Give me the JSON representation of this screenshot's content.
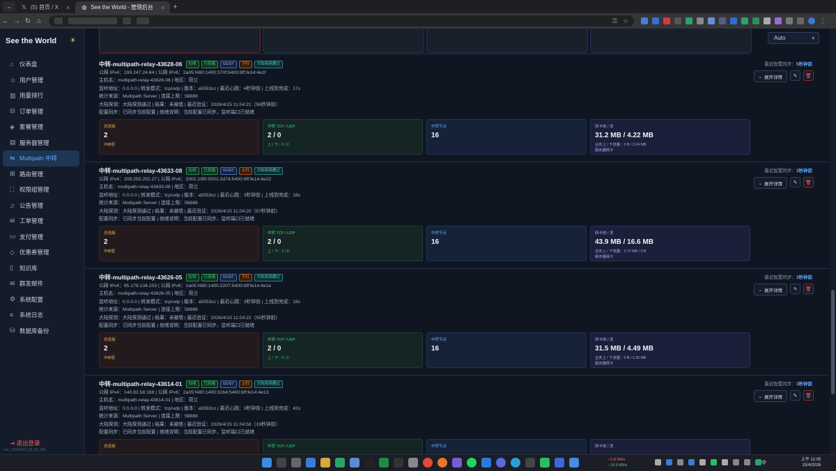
{
  "browser": {
    "tabs": [
      {
        "title": "(5) 首页 / X",
        "icon": "x-logo"
      },
      {
        "title": "See the World - 管理后台",
        "icon": "globe-icon"
      }
    ],
    "new_tab": "+",
    "menu_caret": "⌄"
  },
  "sidebar": {
    "brand": "See the World",
    "theme_icon": "☀",
    "items": [
      {
        "label": "仪表盘",
        "icon": "⌂",
        "active": false
      },
      {
        "label": "用户管理",
        "icon": "☺",
        "active": false
      },
      {
        "label": "用量排行",
        "icon": "▥",
        "active": false
      },
      {
        "label": "订单管理",
        "icon": "⊟",
        "active": false
      },
      {
        "label": "套餐管理",
        "icon": "◈",
        "active": false
      },
      {
        "label": "服务器管理",
        "icon": "▤",
        "active": false
      },
      {
        "label": "Multipath 中转",
        "icon": "⇋",
        "active": true
      },
      {
        "label": "路由管理",
        "icon": "⊞",
        "active": false
      },
      {
        "label": "权限组管理",
        "icon": "⛶",
        "active": false
      },
      {
        "label": "公告管理",
        "icon": "♫",
        "active": false
      },
      {
        "label": "工单管理",
        "icon": "✉",
        "active": false
      },
      {
        "label": "支付管理",
        "icon": "▭",
        "active": false
      },
      {
        "label": "优惠券管理",
        "icon": "◇",
        "active": false
      },
      {
        "label": "知识库",
        "icon": "▯",
        "active": false
      },
      {
        "label": "群发邮件",
        "icon": "✉",
        "active": false
      },
      {
        "label": "系统配置",
        "icon": "⚙",
        "active": false
      },
      {
        "label": "系统日志",
        "icon": "≡",
        "active": false
      },
      {
        "label": "数据库备份",
        "icon": "⛁",
        "active": false
      }
    ],
    "logout": "退出登录",
    "logout_icon": "⇥",
    "version": "ver_20260415_02_04_334"
  },
  "toolbar": {
    "select_value": "Auto"
  },
  "cards": [
    {
      "name": "中转-multipath-relay-43628-06",
      "tags": [
        "在线",
        "已就绪",
        "GOST",
        "下行",
        "大陆探测通过"
      ],
      "ip": "公网 IPv4：199.247.24.64 | 公网 IPv6：2a05:f480:1400:370f:5400:6ff:fe14:4e1f",
      "host": "主机名：multipath-relay-43628-06 | 地区：荷兰",
      "listen": "监听地址：0.0.0.0 | 转发模式：tcp/udp | 版本：a5553cc | 最近心跳：4秒钟前 | 上线到完成：17s",
      "source": "统计来源：Multipath Server | 连接上限：58888",
      "probe": "大陆探测：大陆探测通过 | 结果：未被墙 | 最近验证：2026/4/15 11:04:21（56秒钟前）",
      "config": "配置同步：已同步当前配置 | 就绪说明：当前配置已同步，监听端口已就绪",
      "sync_label": "最近配置同步：",
      "sync_value": "5秒钟前",
      "expand": "展开详情",
      "stats": {
        "conn_label": "总连接",
        "conn_value": "2",
        "conn_sub": "中转层",
        "tcp_label": "中转 TCP / UDP",
        "tcp_value": "2 / 0",
        "tcp_sub": "上 / 下：0 / 2",
        "node_label": "中转节点",
        "node_value": "16",
        "nic_label": "网卡收 / 发",
        "nic_value": "31.2 MB / 4.22 MB",
        "nic_sub": "业务上 / 下流量：0 B / 2.24 MB",
        "nic_sub2": "服务器网卡"
      }
    },
    {
      "name": "中转-multipath-relay-43633-08",
      "tags": [
        "在线",
        "已就绪",
        "GOST",
        "上行",
        "大陆探测通过"
      ],
      "ip": "公网 IPv4：209.250.252.27 | 公网 IPv6：2001:19f0:5001:3d74:5400:6ff:fe14:4e22",
      "host": "主机名：multipath-relay-43633-08 | 地区：荷兰",
      "listen": "监听地址：0.0.0.0 | 转发模式：tcp/udp | 版本：a5553cc | 最近心跳：3秒钟前 | 上线到完成：18s",
      "source": "统计来源：Multipath Server | 连接上限：58888",
      "probe": "大陆探测：大陆探测通过 | 结果：未被墙 | 最近验证：2026/4/15 11:04:20（57秒钟前）",
      "config": "配置同步：已同步当前配置 | 就绪说明：当前配置已同步，监听端口已就绪",
      "sync_label": "最近配置同步：",
      "sync_value": "3秒钟前",
      "expand": "展开详情",
      "stats": {
        "conn_label": "总连接",
        "conn_value": "2",
        "conn_sub": "中转层",
        "tcp_label": "中转 TCP / UDP",
        "tcp_value": "2 / 0",
        "tcp_sub": "上 / 下：2 / 0",
        "node_label": "中转节点",
        "node_value": "16",
        "nic_label": "网卡收 / 发",
        "nic_value": "43.9 MB / 16.6 MB",
        "nic_sub": "业务上 / 下流量：3.72 MB / 0 B",
        "nic_sub2": "服务器网卡"
      }
    },
    {
      "name": "中转-multipath-relay-43626-05",
      "tags": [
        "在线",
        "已就绪",
        "GOST",
        "下行",
        "大陆探测通过"
      ],
      "ip": "公网 IPv4：95.179.134.203 | 公网 IPv6：2a05:f480:1400:2207:5400:6ff:fe14:4e1e",
      "host": "主机名：multipath-relay-43626-05 | 地区：荷兰",
      "listen": "监听地址：0.0.0.0 | 转发模式：tcp/udp | 版本：a5553cc | 最近心跳：3秒钟前 | 上线到完成：18s",
      "source": "统计来源：Multipath Server | 连接上限：58888",
      "probe": "大陆探测：大陆探测通过 | 结果：未被墙 | 最近验证：2026/4/15 11:04:22（55秒钟前）",
      "config": "配置同步：已同步当前配置 | 就绪说明：当前配置已同步，监听端口已就绪",
      "sync_label": "最近配置同步：",
      "sync_value": "3秒钟前",
      "expand": "展开详情",
      "stats": {
        "conn_label": "总连接",
        "conn_value": "2",
        "conn_sub": "中转层",
        "tcp_label": "中转 TCP / UDP",
        "tcp_value": "2 / 0",
        "tcp_sub": "上 / 下：0 / 2",
        "node_label": "中转节点",
        "node_value": "16",
        "nic_label": "网卡收 / 发",
        "nic_value": "31.5 MB / 4.49 MB",
        "nic_sub": "业务上 / 下流量：0 B / 2.35 MB",
        "nic_sub2": "服务器网卡"
      }
    },
    {
      "name": "中转-multipath-relay-43614-01",
      "tags": [
        "在线",
        "已就绪",
        "GOST",
        "上行",
        "大陆探测通过"
      ],
      "ip": "公网 IPv4：140.82.58.169 | 公网 IPv6：2a05:f480:1400:32b4:5400:6ff:fe14:4e13",
      "host": "主机名：multipath-relay-43614-01 | 地区：荷兰",
      "listen": "监听地址：0.0.0.0 | 转发模式：tcp/udp | 版本：a5553cc | 最近心跳：3秒钟前 | 上线到完成：42s",
      "source": "统计来源：Multipath Server | 连接上限：58888",
      "probe": "大陆探测：大陆探测通过 | 结果：未被墙 | 最近验证：2026/4/15 11:04:58（19秒钟前）",
      "config": "配置同步：已同步当前配置 | 就绪说明：当前配置已同步，监听端口已就绪",
      "sync_label": "最近配置同步：",
      "sync_value": "3秒钟前",
      "expand": "展开详情",
      "stats": {
        "conn_label": "总连接",
        "conn_value": "",
        "conn_sub": "",
        "tcp_label": "中转 TCP / UDP",
        "tcp_value": "",
        "tcp_sub": "",
        "node_label": "中转节点",
        "node_value": "",
        "nic_label": "网卡收 / 发",
        "nic_value": "",
        "nic_sub": "",
        "nic_sub2": ""
      }
    }
  ],
  "taskbar": {
    "net_up": "↑ 5.8 KB/s",
    "net_down": "↓ 16.9 KB/s",
    "lang": "中",
    "time": "上午 11:05",
    "date": "15/4/2026"
  },
  "colors": {
    "accent": "#5fa8ff",
    "danger": "#ff5a5a",
    "ok": "#3fd07a",
    "warn": "#ff8e3c"
  }
}
